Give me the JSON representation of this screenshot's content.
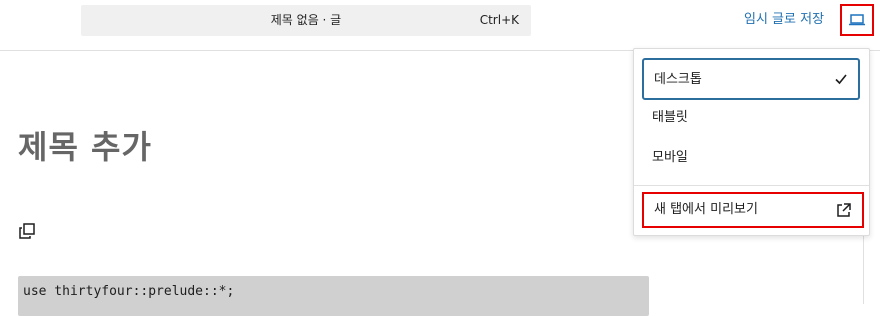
{
  "header": {
    "command_title": "제목 없음 · 글",
    "command_shortcut": "Ctrl+K",
    "save_draft_label": "임시 글로 저장",
    "preview_icon": "laptop-icon"
  },
  "editor": {
    "title_placeholder": "제목 추가",
    "block_icon": "copy-icon",
    "code_line": "use thirtyfour::prelude::*;"
  },
  "preview_menu": {
    "items": [
      {
        "label": "데스크톱",
        "selected": true,
        "icon": "check-icon"
      },
      {
        "label": "태블릿",
        "selected": false
      },
      {
        "label": "모바일",
        "selected": false
      }
    ],
    "new_tab": {
      "label": "새 탭에서 미리보기",
      "icon": "external-link-icon"
    }
  },
  "colors": {
    "accent": "#2271b1",
    "highlight_red": "#e60000",
    "selected_border": "#2c6e9e"
  }
}
